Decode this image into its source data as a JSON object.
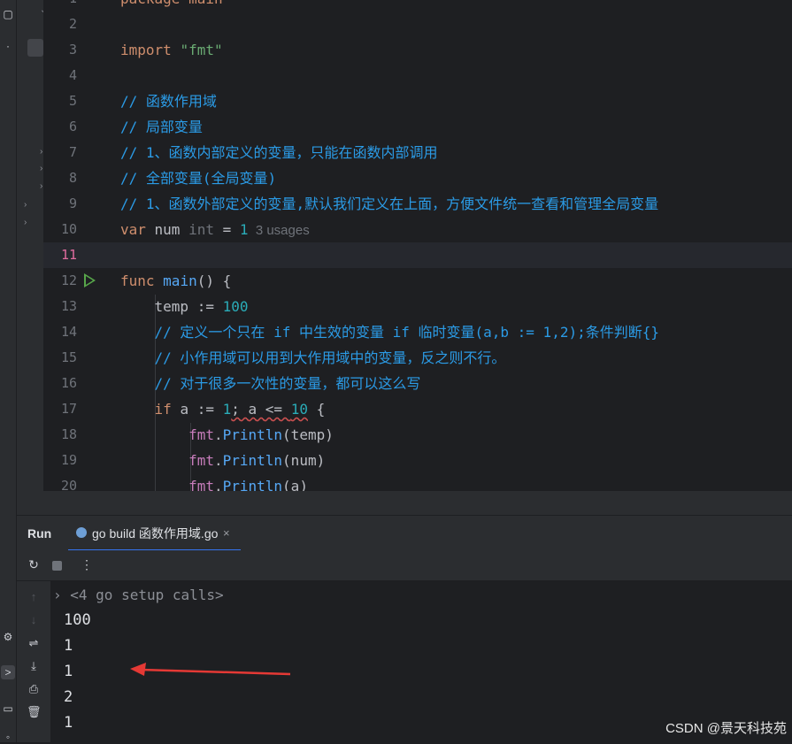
{
  "editor": {
    "lines": [
      {
        "n": "1",
        "tokens": [
          {
            "t": "package main",
            "c": "kw"
          }
        ]
      },
      {
        "n": "2",
        "tokens": []
      },
      {
        "n": "3",
        "tokens": [
          {
            "t": "import ",
            "c": "kw"
          },
          {
            "t": "\"fmt\"",
            "c": "str"
          }
        ]
      },
      {
        "n": "4",
        "tokens": []
      },
      {
        "n": "5",
        "tokens": [
          {
            "t": "// 函数作用域",
            "c": "cm"
          }
        ]
      },
      {
        "n": "6",
        "tokens": [
          {
            "t": "// 局部变量",
            "c": "cm"
          }
        ]
      },
      {
        "n": "7",
        "tokens": [
          {
            "t": "// 1、函数内部定义的变量，只能在函数内部调用",
            "c": "cm"
          }
        ]
      },
      {
        "n": "8",
        "tokens": [
          {
            "t": "// 全部变量(全局变量)",
            "c": "cm"
          }
        ]
      },
      {
        "n": "9",
        "tokens": [
          {
            "t": "// 1、函数外部定义的变量,默认我们定义在上面，方便文件统一查看和管理全局变量",
            "c": "cm"
          }
        ]
      },
      {
        "n": "10",
        "tokens": [
          {
            "t": "var ",
            "c": "kw"
          },
          {
            "t": "num ",
            "c": "var"
          },
          {
            "t": "int ",
            "c": "typ"
          },
          {
            "t": "= ",
            "c": "var"
          },
          {
            "t": "1",
            "c": "num"
          },
          {
            "t": "  3 usages",
            "c": "hint"
          }
        ]
      },
      {
        "n": "11",
        "tokens": [],
        "current": true
      },
      {
        "n": "12",
        "tokens": [
          {
            "t": "func ",
            "c": "kw"
          },
          {
            "t": "main",
            "c": "fn"
          },
          {
            "t": "() {",
            "c": "var"
          }
        ],
        "run": true
      },
      {
        "n": "13",
        "tokens": [
          {
            "t": "    temp := ",
            "c": "var"
          },
          {
            "t": "100",
            "c": "num"
          }
        ]
      },
      {
        "n": "14",
        "tokens": [
          {
            "t": "    // 定义一个只在 if 中生效的变量 if 临时变量(a,b := 1,2);条件判断{}",
            "c": "cm"
          }
        ]
      },
      {
        "n": "15",
        "tokens": [
          {
            "t": "    // 小作用域可以用到大作用域中的变量，反之则不行。",
            "c": "cm"
          }
        ]
      },
      {
        "n": "16",
        "tokens": [
          {
            "t": "    // 对于很多一次性的变量，都可以这么写",
            "c": "cm"
          }
        ]
      },
      {
        "n": "17",
        "tokens": [
          {
            "t": "    if ",
            "c": "kw"
          },
          {
            "t": "a := ",
            "c": "var"
          },
          {
            "t": "1",
            "c": "num"
          },
          {
            "t": "; a <= ",
            "c": "var squiggle"
          },
          {
            "t": "10",
            "c": "num squiggle"
          },
          {
            "t": " {",
            "c": "var"
          }
        ]
      },
      {
        "n": "18",
        "tokens": [
          {
            "t": "        fmt",
            "c": "pkg"
          },
          {
            "t": ".",
            "c": "var"
          },
          {
            "t": "Println",
            "c": "fn"
          },
          {
            "t": "(temp)",
            "c": "var"
          }
        ]
      },
      {
        "n": "19",
        "tokens": [
          {
            "t": "        fmt",
            "c": "pkg"
          },
          {
            "t": ".",
            "c": "var"
          },
          {
            "t": "Println",
            "c": "fn"
          },
          {
            "t": "(num)",
            "c": "var"
          }
        ]
      },
      {
        "n": "20",
        "tokens": [
          {
            "t": "        fmt",
            "c": "pkg"
          },
          {
            "t": ".",
            "c": "var"
          },
          {
            "t": "Println",
            "c": "fn"
          },
          {
            "t": "(a)",
            "c": "var"
          }
        ]
      }
    ]
  },
  "run_panel": {
    "title": "Run",
    "tab_label": "go build 函数作用域.go",
    "tab_close": "×",
    "setup_calls": "<4 go setup calls>",
    "output": [
      "100",
      "1",
      "1",
      "2",
      "1"
    ]
  },
  "watermark": "CSDN @景天科技苑",
  "colors": {
    "background": "#1e1f22",
    "panel": "#2b2d30",
    "keyword": "#cf8e6d",
    "comment": "#2b9be6",
    "string": "#6aab73",
    "number": "#2aacb8",
    "function": "#56a8f5",
    "package": "#c77dbb",
    "arrow": "#e53935",
    "tab_underline": "#3574f0"
  }
}
